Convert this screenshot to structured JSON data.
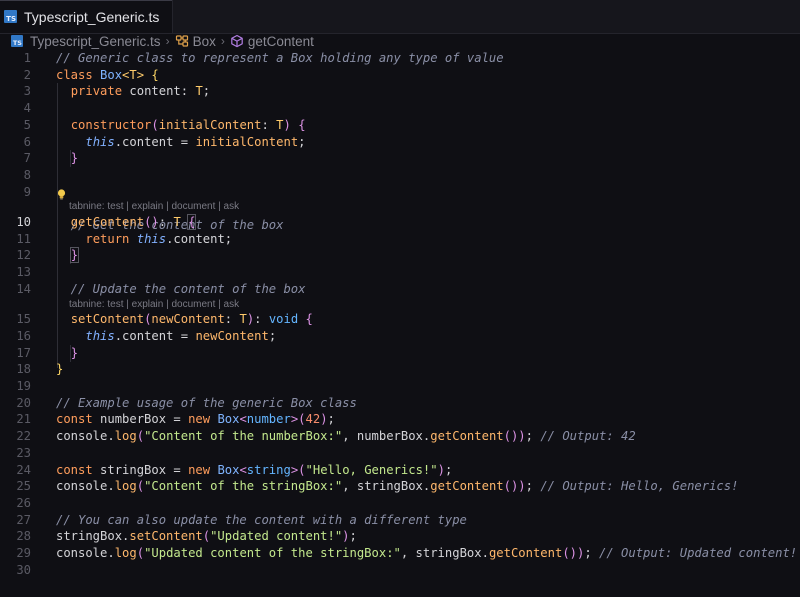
{
  "tab": {
    "filename": "Typescript_Generic.ts",
    "icon": "TS"
  },
  "breadcrumb": {
    "file": "Typescript_Generic.ts",
    "class": "Box",
    "method": "getContent"
  },
  "codelens": "tabnine: test | explain | document | ask",
  "active_line": 10,
  "line_numbers": [
    "1",
    "2",
    "3",
    "4",
    "5",
    "6",
    "7",
    "8",
    "9",
    "10",
    "11",
    "12",
    "13",
    "14",
    "15",
    "16",
    "17",
    "18",
    "19",
    "20",
    "21",
    "22",
    "23",
    "24",
    "25",
    "26",
    "27",
    "28",
    "29",
    "30"
  ],
  "lines": [
    "// Generic class to represent a Box holding any type of value",
    "class Box<T> {",
    "  private content: T;",
    "",
    "  constructor(initialContent: T) {",
    "    this.content = initialContent;",
    "  }",
    "",
    "  // Get the content of the box",
    "  getContent(): T {",
    "    return this.content;",
    "  }",
    "",
    "  // Update the content of the box",
    "  setContent(newContent: T): void {",
    "    this.content = newContent;",
    "  }",
    "}",
    "",
    "// Example usage of the generic Box class",
    "const numberBox = new Box<number>(42);",
    "console.log(\"Content of the numberBox:\", numberBox.getContent()); // Output: 42",
    "",
    "const stringBox = new Box<string>(\"Hello, Generics!\");",
    "console.log(\"Content of the stringBox:\", stringBox.getContent()); // Output: Hello, Generics!",
    "",
    "// You can also update the content with a different type",
    "stringBox.setContent(\"Updated content!\");",
    "console.log(\"Updated content of the stringBox:\", stringBox.getContent()); // Output: Updated content!",
    ""
  ],
  "colors": {
    "background": "#0f0f14",
    "ts_icon": "#3178c6",
    "keyword": "#ff9d5c",
    "comment": "#8a8fa6",
    "string": "#c3e88d"
  },
  "icons": {
    "tab": "typescript-file-icon",
    "class": "class-symbol-icon",
    "method": "method-cube-icon",
    "hint": "lightbulb-icon"
  }
}
